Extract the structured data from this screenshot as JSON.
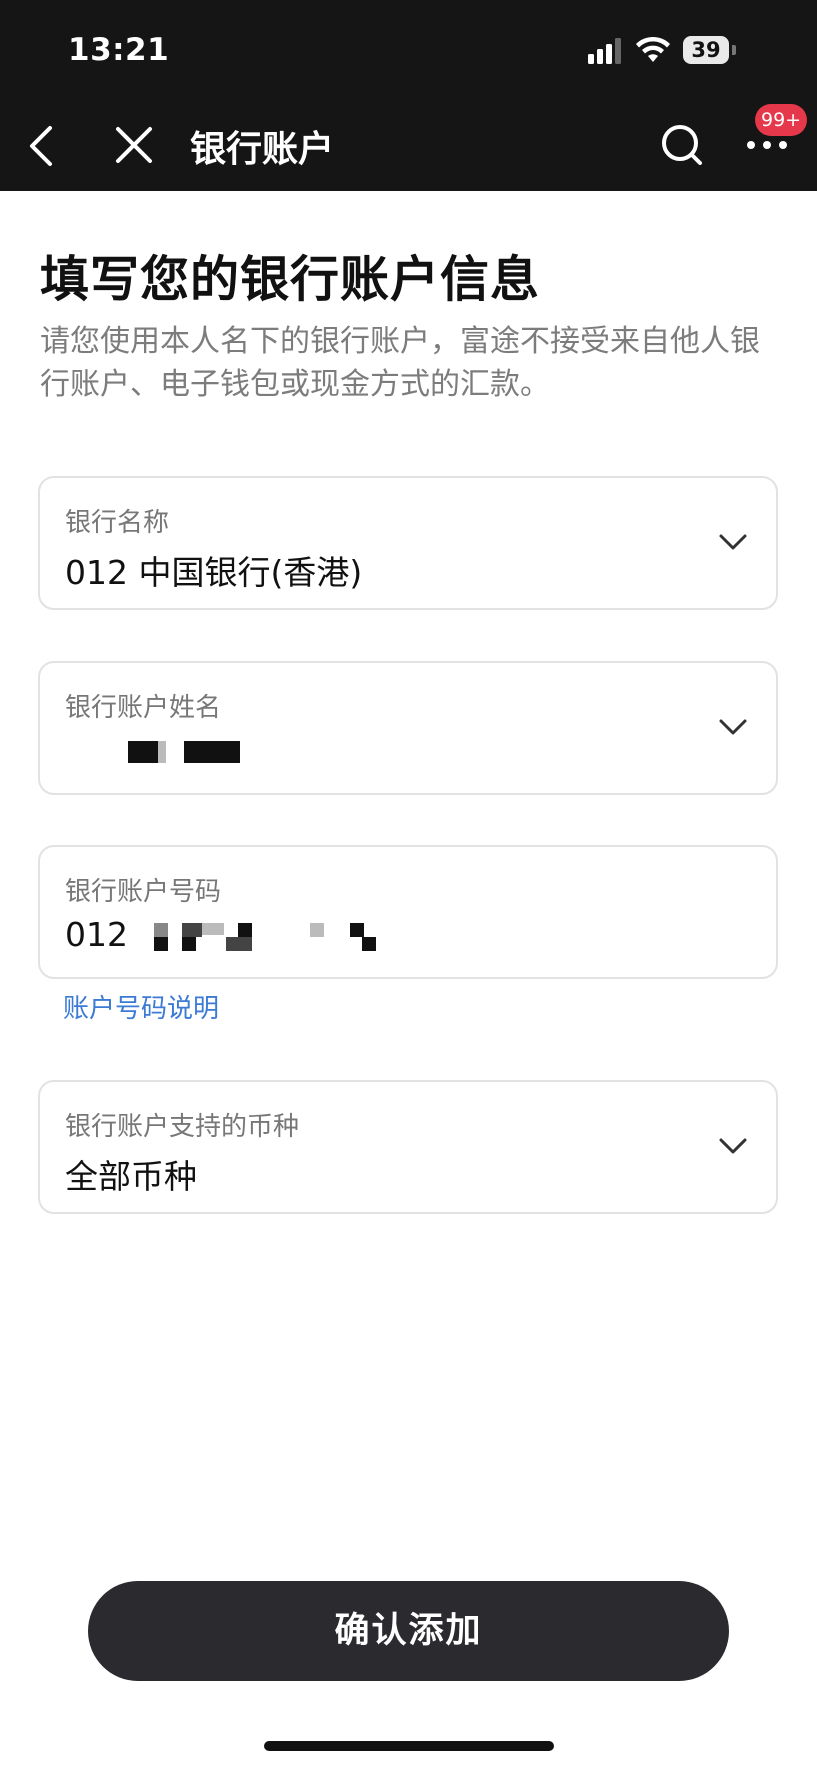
{
  "status_bar": {
    "time": "13:21",
    "battery": "39",
    "icons": [
      "signal-icon",
      "wifi-icon",
      "battery-icon"
    ]
  },
  "nav": {
    "title": "银行账户",
    "badge": "99+",
    "icons": [
      "back-icon",
      "close-icon",
      "search-icon",
      "more-icon"
    ]
  },
  "page": {
    "title": "填写您的银行账户信息",
    "description": "请您使用本人名下的银行账户，富途不接受来自他人银行账户、电子钱包或现金方式的汇款。"
  },
  "fields": {
    "bank_name": {
      "label": "银行名称",
      "value": "012 中国银行(香港)"
    },
    "account_name": {
      "label": "银行账户姓名",
      "value": ""
    },
    "account_number": {
      "label": "银行账户号码",
      "value": "012"
    },
    "account_number_help": "账户号码说明",
    "currency": {
      "label": "银行账户支持的币种",
      "value": "全部币种"
    }
  },
  "actions": {
    "confirm_label": "确认添加"
  },
  "colors": {
    "header_bg": "#151515",
    "badge": "#e5384a",
    "link": "#3b7bd4",
    "button_bg": "#2b2b2f"
  }
}
